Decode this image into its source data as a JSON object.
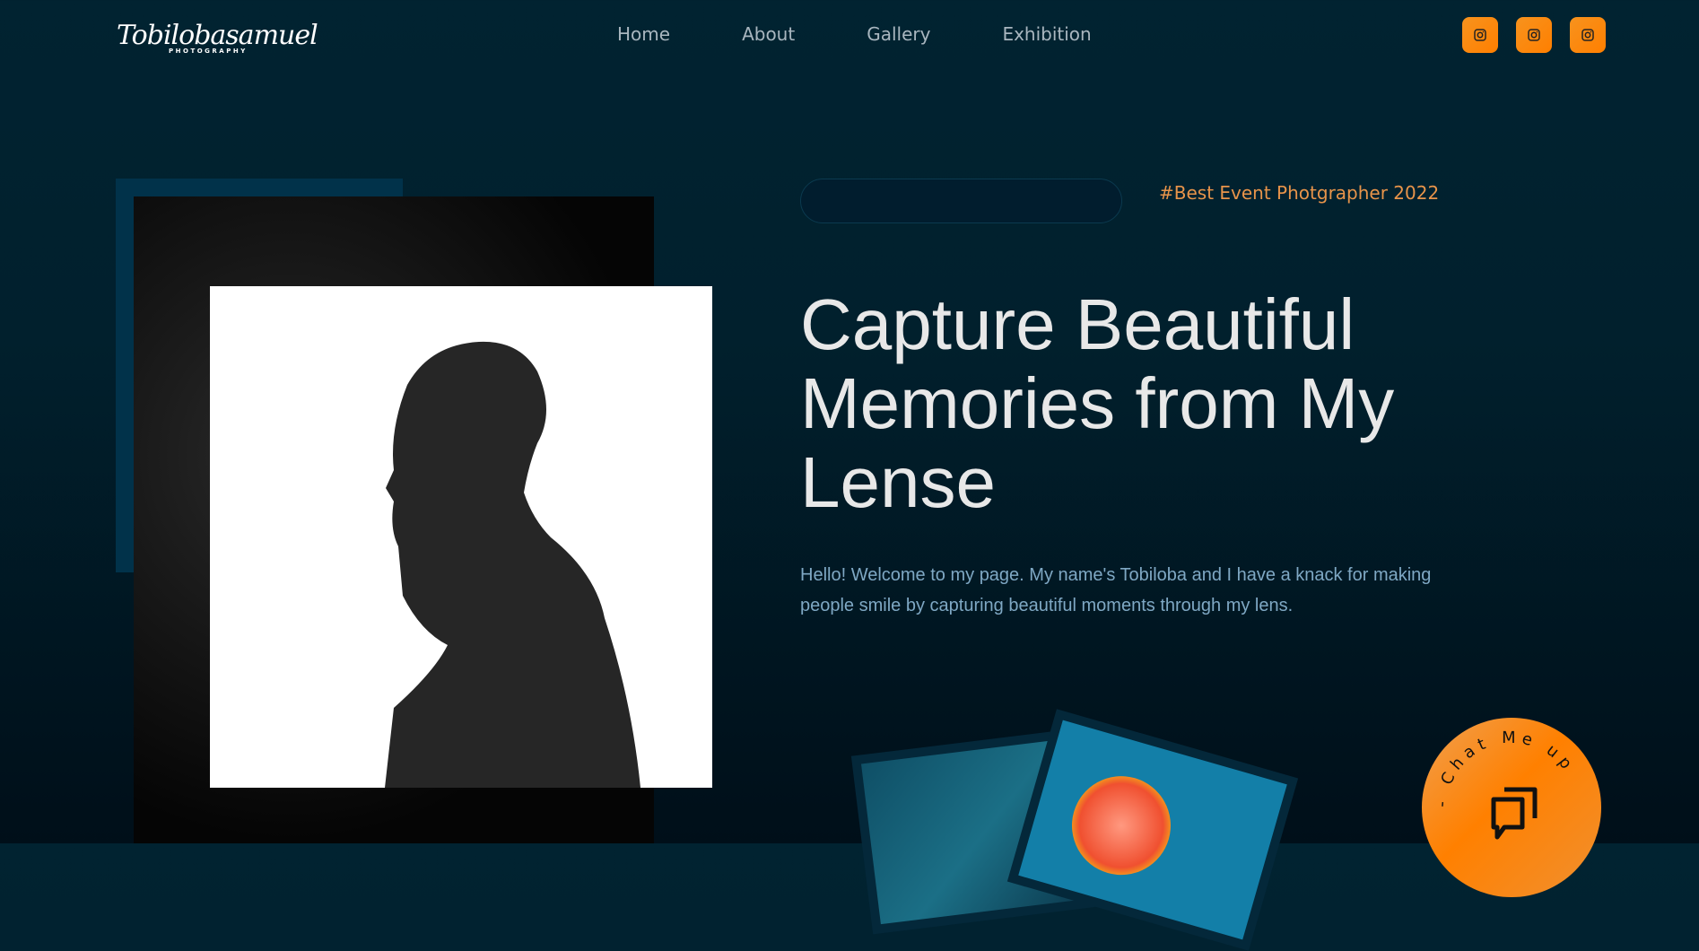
{
  "logo": {
    "name": "Tobilobasamuel",
    "tagline": "PHOTOGRAPHY"
  },
  "nav": [
    "Home",
    "About",
    "Gallery",
    "Exhibition"
  ],
  "social": [
    {
      "icon": "instagram-icon"
    },
    {
      "icon": "instagram-icon"
    },
    {
      "icon": "instagram-icon"
    }
  ],
  "hero": {
    "tag": "#Best Event Photgrapher 2022",
    "title": "Capture Beautiful Memories from My Lense",
    "intro": "Hello! Welcome to my page. My name's Tobiloba and I have a knack for making people smile by capturing beautiful moments through my lens."
  },
  "chat": {
    "label": "- Chat Me up"
  },
  "colors": {
    "accent": "#ff8000",
    "background": "#012331"
  }
}
